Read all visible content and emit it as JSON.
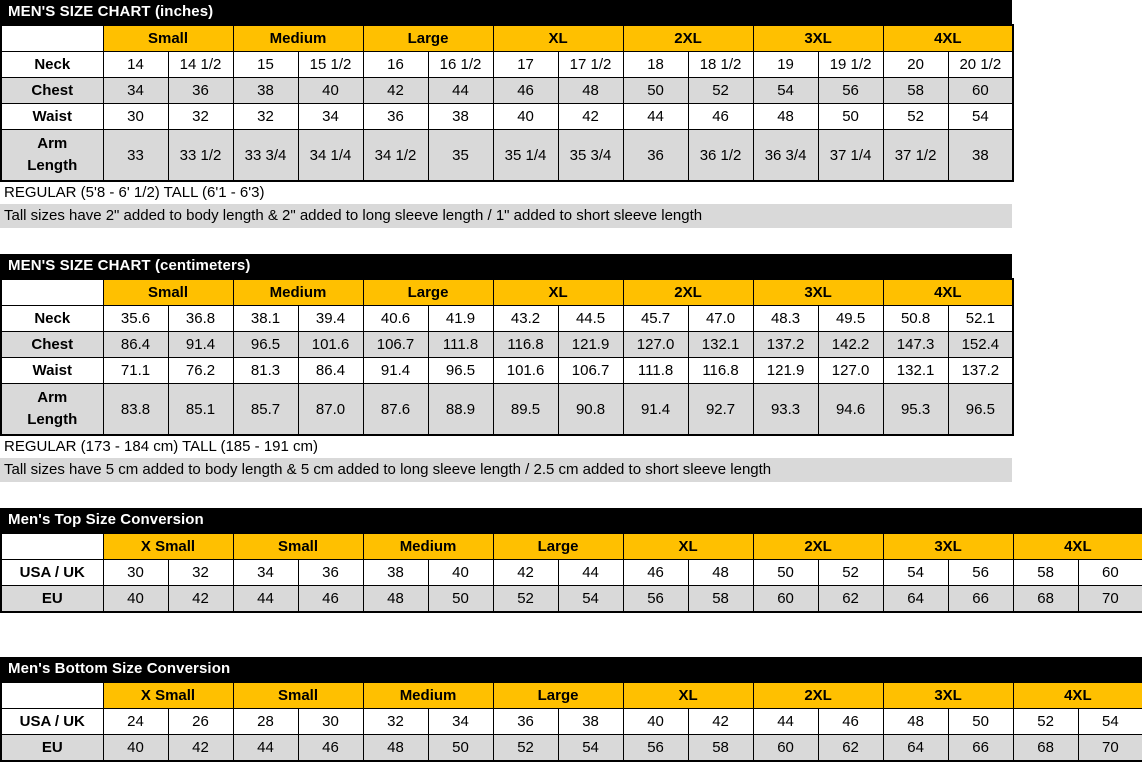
{
  "charts": [
    {
      "id": "mens-inches",
      "title": "MEN'S SIZE CHART (inches)",
      "size_headers": [
        "Small",
        "Medium",
        "Large",
        "XL",
        "2XL",
        "3XL",
        "4XL"
      ],
      "rows": [
        {
          "label": "Neck",
          "values": [
            "14",
            "14 1/2",
            "15",
            "15 1/2",
            "16",
            "16 1/2",
            "17",
            "17 1/2",
            "18",
            "18 1/2",
            "19",
            "19 1/2",
            "20",
            "20 1/2"
          ]
        },
        {
          "label": "Chest",
          "values": [
            "34",
            "36",
            "38",
            "40",
            "42",
            "44",
            "46",
            "48",
            "50",
            "52",
            "54",
            "56",
            "58",
            "60"
          ]
        },
        {
          "label": "Waist",
          "values": [
            "30",
            "32",
            "32",
            "34",
            "36",
            "38",
            "40",
            "42",
            "44",
            "46",
            "48",
            "50",
            "52",
            "54"
          ]
        },
        {
          "label_line1": "Arm",
          "label_line2": "Length",
          "values": [
            "33",
            "33 1/2",
            "33 3/4",
            "34 1/4",
            "34 1/2",
            "35",
            "35 1/4",
            "35 3/4",
            "36",
            "36 1/2",
            "36 3/4",
            "37 1/4",
            "37 1/2",
            "38"
          ]
        }
      ],
      "note_plain": "REGULAR (5'8 - 6' 1/2)  TALL (6'1 - 6'3)",
      "note_shaded": "Tall sizes have 2\" added to body length & 2\" added to long sleeve length / 1\" added to short sleeve length"
    },
    {
      "id": "mens-centimeters",
      "title": "MEN'S SIZE CHART (centimeters)",
      "size_headers": [
        "Small",
        "Medium",
        "Large",
        "XL",
        "2XL",
        "3XL",
        "4XL"
      ],
      "rows": [
        {
          "label": "Neck",
          "values": [
            "35.6",
            "36.8",
            "38.1",
            "39.4",
            "40.6",
            "41.9",
            "43.2",
            "44.5",
            "45.7",
            "47.0",
            "48.3",
            "49.5",
            "50.8",
            "52.1"
          ]
        },
        {
          "label": "Chest",
          "values": [
            "86.4",
            "91.4",
            "96.5",
            "101.6",
            "106.7",
            "111.8",
            "116.8",
            "121.9",
            "127.0",
            "132.1",
            "137.2",
            "142.2",
            "147.3",
            "152.4"
          ]
        },
        {
          "label": "Waist",
          "values": [
            "71.1",
            "76.2",
            "81.3",
            "86.4",
            "91.4",
            "96.5",
            "101.6",
            "106.7",
            "111.8",
            "116.8",
            "121.9",
            "127.0",
            "132.1",
            "137.2"
          ]
        },
        {
          "label_line1": "Arm",
          "label_line2": "Length",
          "values": [
            "83.8",
            "85.1",
            "85.7",
            "87.0",
            "87.6",
            "88.9",
            "89.5",
            "90.8",
            "91.4",
            "92.7",
            "93.3",
            "94.6",
            "95.3",
            "96.5"
          ]
        }
      ],
      "note_plain": "REGULAR (173 - 184 cm)  TALL (185 - 191 cm)",
      "note_shaded": "Tall sizes have 5 cm added to body length & 5 cm added to long sleeve length / 2.5 cm added to short sleeve length"
    }
  ],
  "conversions": [
    {
      "id": "mens-top-conversion",
      "title": "Men's Top Size Conversion",
      "size_headers": [
        "X Small",
        "Small",
        "Medium",
        "Large",
        "XL",
        "2XL",
        "3XL",
        "4XL"
      ],
      "rows": [
        {
          "label": "USA / UK",
          "values": [
            "30",
            "32",
            "34",
            "36",
            "38",
            "40",
            "42",
            "44",
            "46",
            "48",
            "50",
            "52",
            "54",
            "56",
            "58",
            "60"
          ]
        },
        {
          "label": "EU",
          "values": [
            "40",
            "42",
            "44",
            "46",
            "48",
            "50",
            "52",
            "54",
            "56",
            "58",
            "60",
            "62",
            "64",
            "66",
            "68",
            "70"
          ]
        }
      ]
    },
    {
      "id": "mens-bottom-conversion",
      "title": "Men's Bottom Size Conversion",
      "size_headers": [
        "X Small",
        "Small",
        "Medium",
        "Large",
        "XL",
        "2XL",
        "3XL",
        "4XL"
      ],
      "rows": [
        {
          "label": "USA / UK",
          "values": [
            "24",
            "26",
            "28",
            "30",
            "32",
            "34",
            "36",
            "38",
            "40",
            "42",
            "44",
            "46",
            "48",
            "50",
            "52",
            "54"
          ]
        },
        {
          "label": "EU",
          "values": [
            "40",
            "42",
            "44",
            "46",
            "48",
            "50",
            "52",
            "54",
            "56",
            "58",
            "60",
            "62",
            "64",
            "66",
            "68",
            "70"
          ]
        }
      ]
    }
  ],
  "colors": {
    "header_bar": "#000000",
    "size_header": "#FFC000",
    "shaded_row": "#d9d9d9",
    "text": "#000000",
    "header_text": "#ffffff"
  }
}
